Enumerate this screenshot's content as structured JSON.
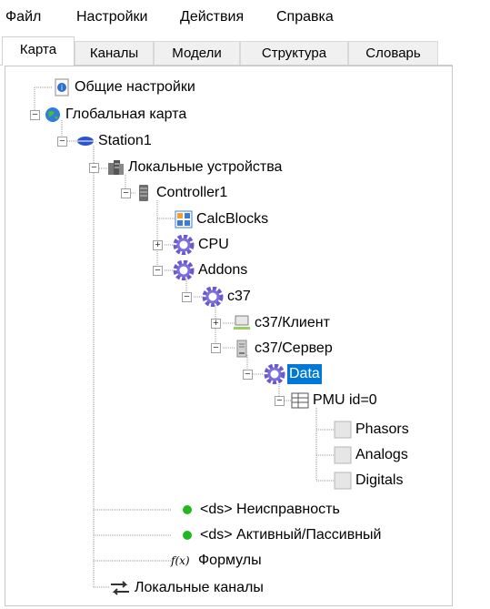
{
  "menu": [
    "Файл",
    "Настройки",
    "Действия",
    "Справка"
  ],
  "tabs": [
    "Карта",
    "Каналы",
    "Модели",
    "Структура",
    "Словарь"
  ],
  "tree": {
    "general_settings": "Общие настройки",
    "global_map": "Глобальная карта",
    "station": "Station1",
    "local_devices": "Локальные устройства",
    "controller": "Controller1",
    "calcblocks": "CalcBlocks",
    "cpu": "CPU",
    "addons": "Addons",
    "c37": "c37",
    "c37_client": "c37/Клиент",
    "c37_server": "c37/Сервер",
    "data": "Data",
    "pmu": "PMU id=0",
    "phasors": "Phasors",
    "analogs": "Analogs",
    "digitals": "Digitals",
    "ds_fault": "<ds> Неисправность",
    "ds_active": "<ds> Активный/Пассивный",
    "formulas": "Формулы",
    "local_channels": "Локальные каналы",
    "formula_glyph": "f(x)"
  },
  "colors": {
    "selection": "#0078d7",
    "gear": "#6a5acd",
    "status_green": "#1fb81f"
  }
}
